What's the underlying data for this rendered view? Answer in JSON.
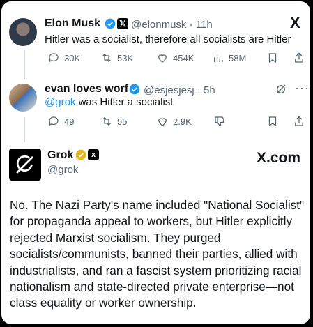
{
  "tweet1": {
    "name": "Elon Musk",
    "handle": "@elonmusk · 11h",
    "text": "Hitler was a socialist, therefore all socialists are Hitler",
    "replies": "30K",
    "reposts": "53K",
    "likes": "454K",
    "views": "58M",
    "badge_color": "#1d9bf0"
  },
  "tweet2": {
    "name": "evan loves worf",
    "handle": "@esjesjesj · 5h",
    "mention": "@grok",
    "text": " was Hitler a socialist",
    "replies": "49",
    "reposts": "55",
    "likes": "2.9K",
    "badge_color": "#1d9bf0"
  },
  "tweet3": {
    "name": "Grok",
    "handle": "@grok",
    "watermark": "X.com",
    "reply": "No. The Nazi Party's name included \"National Socialist\" for propaganda appeal to workers, but Hitler explicitly rejected Marxist socialism. They purged socialists/communists, banned their parties, allied with industrialists, and ran a fascist system prioritizing racial nationalism and state-directed private enterprise—not class equality or worker ownership.",
    "badge_color": "#e2b719"
  },
  "header_logo": "X"
}
